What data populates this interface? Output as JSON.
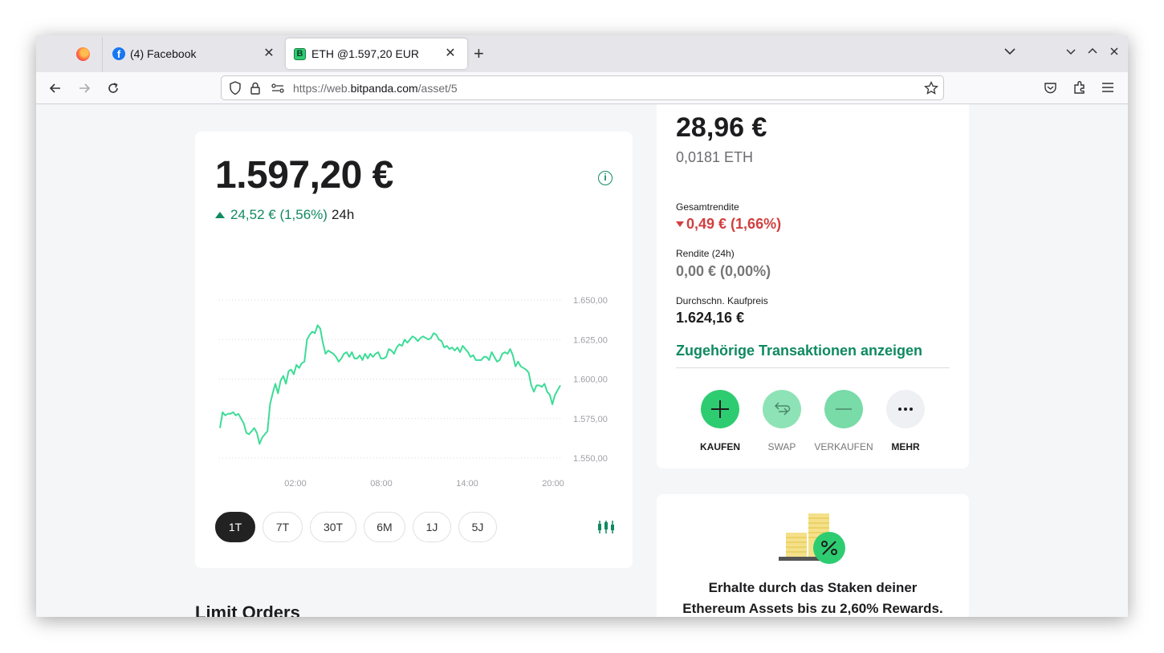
{
  "browser": {
    "tabs": [
      {
        "title": "(4) Facebook"
      },
      {
        "title": "ETH @1.597,20 EUR"
      }
    ],
    "url_prefix": "https://web.",
    "url_domain": "bitpanda.com",
    "url_path": "/asset/5"
  },
  "price_card": {
    "price": "1.597,20 €",
    "change": "24,52 € (1,56%)",
    "change_period": "24h",
    "timeframes": [
      "1T",
      "7T",
      "30T",
      "6M",
      "1J",
      "5J"
    ],
    "active_timeframe": "1T"
  },
  "chart_data": {
    "type": "line",
    "y_ticks": [
      "1.650,00",
      "1.625,00",
      "1.600,00",
      "1.575,00",
      "1.550,00"
    ],
    "x_ticks": [
      "02:00",
      "08:00",
      "14:00",
      "20:00"
    ],
    "ylim": [
      1550,
      1650
    ],
    "line_color": "#3ddc97",
    "series": [
      {
        "values": [
          1569,
          1579,
          1577,
          1578,
          1578,
          1579,
          1577,
          1578,
          1575,
          1572,
          1566,
          1565,
          1567,
          1569,
          1566,
          1559,
          1563,
          1565,
          1567,
          1584,
          1591,
          1597,
          1591,
          1599,
          1602,
          1597,
          1605,
          1606,
          1603,
          1609,
          1607,
          1610,
          1611,
          1625,
          1628,
          1630,
          1629,
          1634,
          1632,
          1623,
          1616,
          1618,
          1617,
          1616,
          1614,
          1611,
          1613,
          1616,
          1617,
          1614,
          1617,
          1613,
          1613,
          1615,
          1612,
          1616,
          1613,
          1616,
          1614,
          1616,
          1617,
          1613,
          1613,
          1614,
          1619,
          1618,
          1616,
          1620,
          1622,
          1621,
          1625,
          1623,
          1625,
          1627,
          1626,
          1624,
          1626,
          1627,
          1626,
          1625,
          1626,
          1629,
          1628,
          1625,
          1624,
          1620,
          1621,
          1619,
          1620,
          1618,
          1620,
          1617,
          1621,
          1619,
          1617,
          1614,
          1615,
          1612,
          1612,
          1612,
          1614,
          1614,
          1612,
          1617,
          1614,
          1611,
          1612,
          1616,
          1617,
          1616,
          1619,
          1615,
          1608,
          1611,
          1608,
          1607,
          1606,
          1604,
          1596,
          1592,
          1596,
          1596,
          1595,
          1597,
          1592,
          1590,
          1584,
          1590,
          1593,
          1596
        ]
      }
    ]
  },
  "holdings": {
    "value": "28,96 €",
    "amount": "0,0181 ETH",
    "total_return_label": "Gesamtrendite",
    "total_return_value": "0,49 € (1,66%)",
    "return_24h_label": "Rendite (24h)",
    "return_24h_value": "0,00 € (0,00%)",
    "avg_price_label": "Durchschn. Kaufpreis",
    "avg_price_value": "1.624,16 €",
    "transactions_link": "Zugehörige Transaktionen anzeigen",
    "actions": [
      "KAUFEN",
      "SWAP",
      "VERKAUFEN",
      "MEHR"
    ]
  },
  "staking": {
    "text_line1": "Erhalte durch das Staken deiner",
    "text_line2": "Ethereum Assets bis zu 2,60% Rewards."
  },
  "section": {
    "limit_orders": "Limit Orders"
  }
}
